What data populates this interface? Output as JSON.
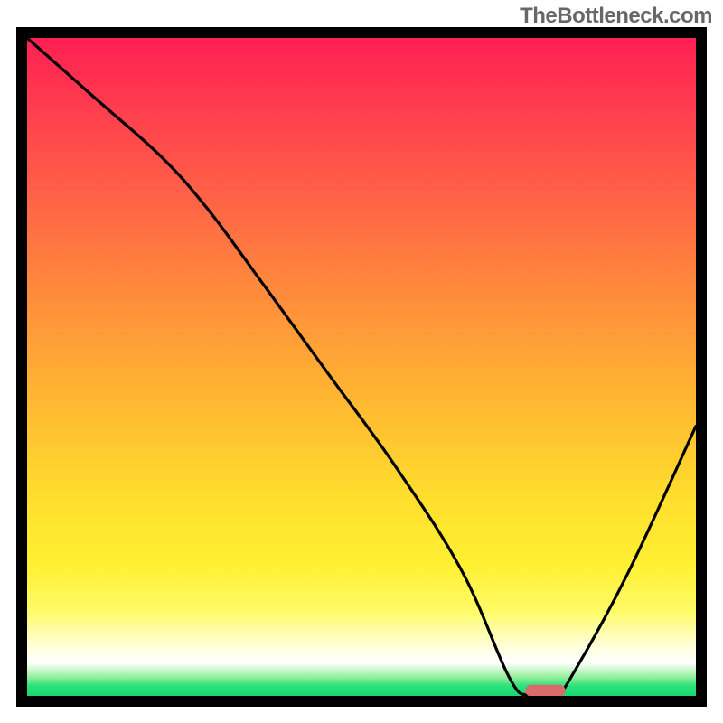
{
  "watermark": "TheBottleneck.com",
  "chart_data": {
    "type": "line",
    "title": "",
    "xlabel": "",
    "ylabel": "",
    "xlim": [
      0,
      100
    ],
    "ylim": [
      0,
      100
    ],
    "grid": false,
    "legend": false,
    "gradient_stops": [
      {
        "pos": 0,
        "color": "#ff1f52"
      },
      {
        "pos": 0.46,
        "color": "#ff9f37"
      },
      {
        "pos": 0.8,
        "color": "#fff032"
      },
      {
        "pos": 0.93,
        "color": "#ffffe4"
      },
      {
        "pos": 0.95,
        "color": "#ffffff"
      },
      {
        "pos": 0.985,
        "color": "#2ae27a"
      },
      {
        "pos": 1.0,
        "color": "#1cd871"
      }
    ],
    "series": [
      {
        "name": "bottleneck-curve",
        "color": "#000000",
        "x": [
          0,
          10,
          20,
          27,
          35,
          45,
          55,
          65,
          72,
          75,
          79,
          82,
          90,
          100
        ],
        "y": [
          100,
          91,
          82,
          74,
          63,
          49,
          35,
          19,
          3,
          0,
          0,
          4,
          19,
          41
        ]
      }
    ],
    "marker": {
      "name": "optimal-zone",
      "shape": "rounded-rect",
      "color": "#d96b6b",
      "x_center": 77.5,
      "y_center": 0.8,
      "width": 6,
      "height": 1.8
    }
  }
}
